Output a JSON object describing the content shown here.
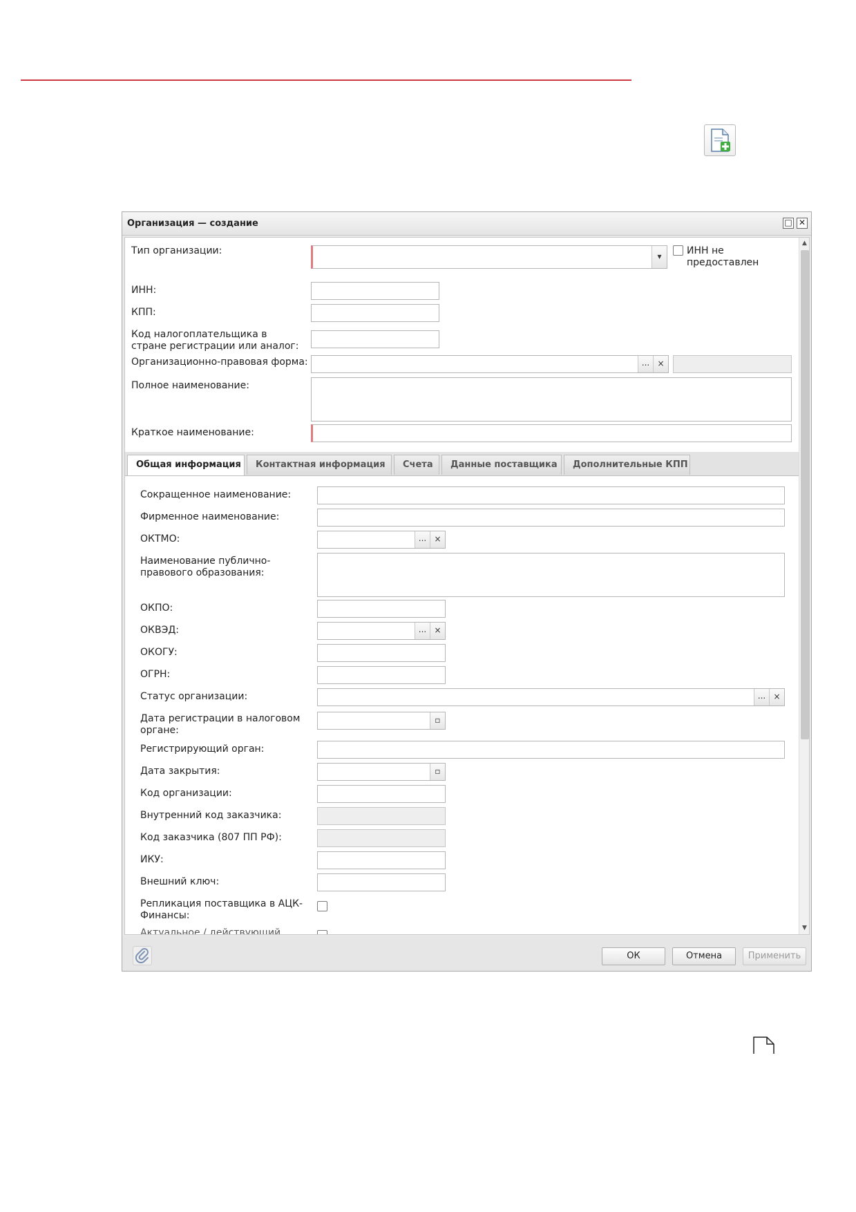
{
  "icons": {
    "add_document": "document-add-icon",
    "page": "page-icon",
    "attach": "paperclip-icon"
  },
  "colors": {
    "accent_line": "#d0393f",
    "required": "#e07a80"
  },
  "window": {
    "title": "Организация — создание",
    "maximize_glyph": "□",
    "close_glyph": "✕"
  },
  "form": {
    "org_type_label": "Тип организации:",
    "inn_not_provided_label": "ИНН не предоставлен",
    "inn_label": "ИНН:",
    "kpp_label": "КПП:",
    "tax_code_label": "Код налогоплательщика в стране регистрации или аналог:",
    "legal_form_label": "Организационно-правовая форма:",
    "full_name_label": "Полное наименование:",
    "short_name_label": "Краткое наименование:"
  },
  "glyphs": {
    "more": "...",
    "clear": "×",
    "dropdown": "▾",
    "calendar": "▫"
  },
  "tabs": [
    {
      "label": "Общая информация"
    },
    {
      "label": "Контактная информация"
    },
    {
      "label": "Счета"
    },
    {
      "label": "Данные поставщика"
    },
    {
      "label": "Дополнительные КПП"
    }
  ],
  "general": {
    "abbr_name": "Сокращенное наименование:",
    "brand_name": "Фирменное наименование:",
    "oktmo": "ОКТМО:",
    "public_entity": "Наименование публично-правового образования:",
    "okpo": "ОКПО:",
    "okved": "ОКВЭД:",
    "okogu": "ОКОГУ:",
    "ogrn": "ОГРН:",
    "status": "Статус организации:",
    "reg_date": "Дата регистрации в налоговом органе:",
    "reg_body": "Регистрирующий орган:",
    "close_date": "Дата закрытия:",
    "org_code": "Код организации:",
    "internal_code": "Внутренний код заказчика:",
    "customer_code": "Код заказчика (807 ПП РФ):",
    "iku": "ИКУ:",
    "external_key": "Внешний ключ:",
    "replication": "Репликация поставщика в АЦК-Финансы:",
    "cut_label": "Актуальное / действующий"
  },
  "footer": {
    "ok": "ОК",
    "cancel": "Отмена",
    "apply": "Применить"
  }
}
